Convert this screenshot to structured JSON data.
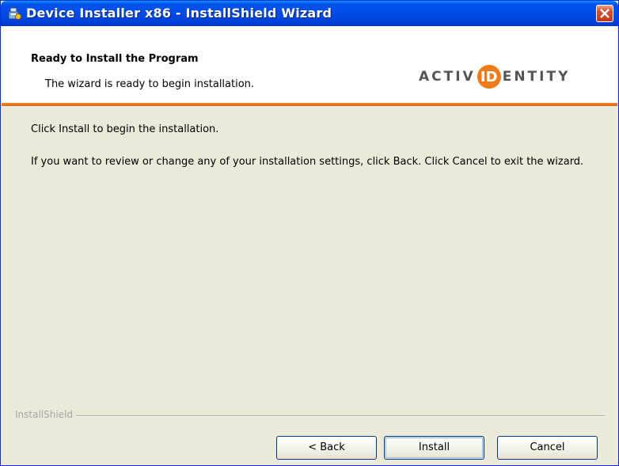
{
  "window": {
    "title": "Device Installer x86 - InstallShield Wizard",
    "icon": "installer-package-icon",
    "close_icon": "close-icon"
  },
  "header": {
    "title": "Ready to Install the Program",
    "subtitle": "The wizard is ready to begin installation.",
    "logo": {
      "left": "ACTIV",
      "mark": "ID",
      "right": "ENTITY",
      "accent_color": "#f07b1b"
    },
    "separator_color": "#e8731a"
  },
  "body": {
    "line1": "Click Install to begin the installation.",
    "line2": "If you want to review or change any of your installation settings, click Back. Click Cancel to exit the wizard."
  },
  "footer": {
    "brand_label": "InstallShield",
    "buttons": {
      "back": "< Back",
      "install": "Install",
      "cancel": "Cancel"
    }
  },
  "colors": {
    "titlebar": "#0050ee",
    "dialog_bg": "#ece9d8",
    "button_border": "#003c74"
  }
}
